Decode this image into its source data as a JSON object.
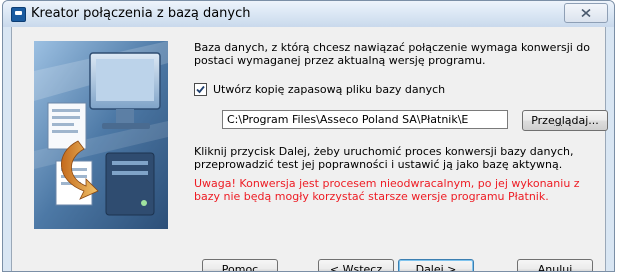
{
  "window": {
    "title": "Kreator połączenia z bazą danych"
  },
  "content": {
    "intro": "Baza danych, z którą chcesz nawiązać połączenie wymaga konwersji do postaci wymaganej przez aktualną wersję programu.",
    "backup_checkbox": {
      "label": "Utwórz kopię zapasową pliku bazy danych",
      "checked": true
    },
    "path_input": {
      "value": "C:\\Program Files\\Asseco Poland SA\\Płatnik\\E"
    },
    "instructions": "Kliknij przycisk Dalej, żeby uruchomić proces konwersji bazy danych, przeprowadzić test jej poprawności i ustawić ją jako bazę aktywną.",
    "warning": "Uwaga! Konwersja jest procesem nieodwracalnym, po jej wykonaniu z bazy nie będą mogły korzystać starsze wersje programu Płatnik."
  },
  "buttons": {
    "browse": {
      "pre": "Prze",
      "key": "g",
      "post": "lądaj..."
    },
    "help": {
      "pre": "",
      "key": "P",
      "post": "omoc"
    },
    "back": {
      "pre": "< ",
      "key": "W",
      "post": "stecz"
    },
    "next": {
      "pre": "",
      "key": "D",
      "post": "alej >"
    },
    "cancel": {
      "pre": "",
      "key": "A",
      "post": "nuluj"
    }
  },
  "colors": {
    "warning": "#ee1c24",
    "dialog_background": "#f0f0f0",
    "frame": "#d9e6f3"
  },
  "icons": {
    "app": "app-icon",
    "close": "close-icon",
    "check": "checkmark-icon"
  }
}
